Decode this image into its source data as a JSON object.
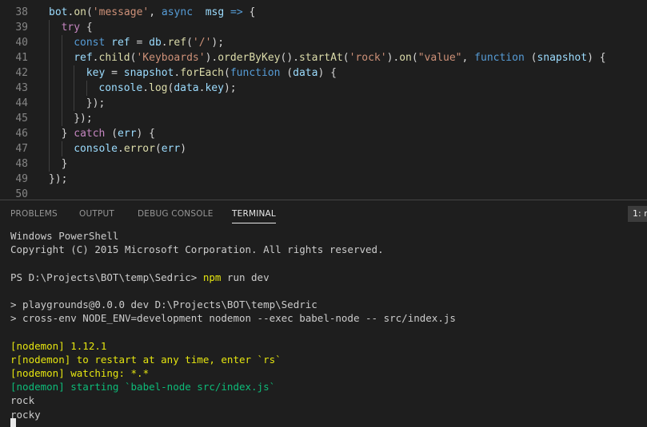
{
  "colors": {
    "keyword": "#c586c0",
    "storage": "#569cd6",
    "variable": "#9cdcfe",
    "function": "#dcdcaa",
    "string": "#ce9178",
    "plain": "#d4d4d4",
    "line_number": "#858585",
    "terminal_yellow": "#e5e510",
    "terminal_green": "#0dbc79"
  },
  "editor": {
    "lines": [
      {
        "num": "38",
        "indent": 0,
        "tokens": [
          {
            "t": "bot",
            "c": "variable"
          },
          {
            "t": ".",
            "c": "plain"
          },
          {
            "t": "on",
            "c": "function"
          },
          {
            "t": "(",
            "c": "plain"
          },
          {
            "t": "'message'",
            "c": "string"
          },
          {
            "t": ", ",
            "c": "plain"
          },
          {
            "t": "async",
            "c": "storage"
          },
          {
            "t": "  ",
            "c": "plain"
          },
          {
            "t": "msg",
            "c": "variable"
          },
          {
            "t": " ",
            "c": "plain"
          },
          {
            "t": "=>",
            "c": "storage"
          },
          {
            "t": " {",
            "c": "plain"
          }
        ]
      },
      {
        "num": "39",
        "indent": 1,
        "tokens": [
          {
            "t": "try",
            "c": "keyword"
          },
          {
            "t": " {",
            "c": "plain"
          }
        ]
      },
      {
        "num": "40",
        "indent": 2,
        "tokens": [
          {
            "t": "const",
            "c": "storage"
          },
          {
            "t": " ",
            "c": "plain"
          },
          {
            "t": "ref",
            "c": "variable"
          },
          {
            "t": " = ",
            "c": "plain"
          },
          {
            "t": "db",
            "c": "variable"
          },
          {
            "t": ".",
            "c": "plain"
          },
          {
            "t": "ref",
            "c": "function"
          },
          {
            "t": "(",
            "c": "plain"
          },
          {
            "t": "'/'",
            "c": "string"
          },
          {
            "t": ");",
            "c": "plain"
          }
        ]
      },
      {
        "num": "41",
        "indent": 2,
        "tokens": [
          {
            "t": "ref",
            "c": "variable"
          },
          {
            "t": ".",
            "c": "plain"
          },
          {
            "t": "child",
            "c": "function"
          },
          {
            "t": "(",
            "c": "plain"
          },
          {
            "t": "'Keyboards'",
            "c": "string"
          },
          {
            "t": ").",
            "c": "plain"
          },
          {
            "t": "orderByKey",
            "c": "function"
          },
          {
            "t": "().",
            "c": "plain"
          },
          {
            "t": "startAt",
            "c": "function"
          },
          {
            "t": "(",
            "c": "plain"
          },
          {
            "t": "'rock'",
            "c": "string"
          },
          {
            "t": ").",
            "c": "plain"
          },
          {
            "t": "on",
            "c": "function"
          },
          {
            "t": "(",
            "c": "plain"
          },
          {
            "t": "\"value\"",
            "c": "string"
          },
          {
            "t": ", ",
            "c": "plain"
          },
          {
            "t": "function",
            "c": "storage"
          },
          {
            "t": " (",
            "c": "plain"
          },
          {
            "t": "snapshot",
            "c": "variable"
          },
          {
            "t": ") {",
            "c": "plain"
          }
        ]
      },
      {
        "num": "42",
        "indent": 3,
        "tokens": [
          {
            "t": "key",
            "c": "variable"
          },
          {
            "t": " = ",
            "c": "plain"
          },
          {
            "t": "snapshot",
            "c": "variable"
          },
          {
            "t": ".",
            "c": "plain"
          },
          {
            "t": "forEach",
            "c": "function"
          },
          {
            "t": "(",
            "c": "plain"
          },
          {
            "t": "function",
            "c": "storage"
          },
          {
            "t": " (",
            "c": "plain"
          },
          {
            "t": "data",
            "c": "variable"
          },
          {
            "t": ") {",
            "c": "plain"
          }
        ]
      },
      {
        "num": "43",
        "indent": 4,
        "tokens": [
          {
            "t": "console",
            "c": "variable"
          },
          {
            "t": ".",
            "c": "plain"
          },
          {
            "t": "log",
            "c": "function"
          },
          {
            "t": "(",
            "c": "plain"
          },
          {
            "t": "data",
            "c": "variable"
          },
          {
            "t": ".",
            "c": "plain"
          },
          {
            "t": "key",
            "c": "variable"
          },
          {
            "t": ");",
            "c": "plain"
          }
        ]
      },
      {
        "num": "44",
        "indent": 3,
        "tokens": [
          {
            "t": "});",
            "c": "plain"
          }
        ]
      },
      {
        "num": "45",
        "indent": 2,
        "tokens": [
          {
            "t": "});",
            "c": "plain"
          }
        ]
      },
      {
        "num": "46",
        "indent": 1,
        "tokens": [
          {
            "t": "} ",
            "c": "plain"
          },
          {
            "t": "catch",
            "c": "keyword"
          },
          {
            "t": " (",
            "c": "plain"
          },
          {
            "t": "err",
            "c": "variable"
          },
          {
            "t": ") {",
            "c": "plain"
          }
        ]
      },
      {
        "num": "47",
        "indent": 2,
        "tokens": [
          {
            "t": "console",
            "c": "variable"
          },
          {
            "t": ".",
            "c": "plain"
          },
          {
            "t": "error",
            "c": "function"
          },
          {
            "t": "(",
            "c": "plain"
          },
          {
            "t": "err",
            "c": "variable"
          },
          {
            "t": ")",
            "c": "plain"
          }
        ]
      },
      {
        "num": "48",
        "indent": 1,
        "tokens": [
          {
            "t": "}",
            "c": "plain"
          }
        ]
      },
      {
        "num": "49",
        "indent": 0,
        "tokens": [
          {
            "t": "});",
            "c": "plain"
          }
        ]
      },
      {
        "num": "50",
        "indent": 0,
        "tokens": []
      }
    ]
  },
  "panel": {
    "tabs": [
      "PROBLEMS",
      "OUTPUT",
      "DEBUG CONSOLE",
      "TERMINAL"
    ],
    "active_tab": "TERMINAL",
    "terminal_selector": "1: r"
  },
  "terminal": {
    "lines": [
      {
        "segments": [
          {
            "t": "Windows PowerShell",
            "c": "plain"
          }
        ]
      },
      {
        "segments": [
          {
            "t": "Copyright (C) 2015 Microsoft Corporation. All rights reserved.",
            "c": "plain"
          }
        ]
      },
      {
        "segments": []
      },
      {
        "segments": [
          {
            "t": "PS D:\\Projects\\BOT\\temp\\Sedric> ",
            "c": "plain"
          },
          {
            "t": "npm",
            "c": "yellow"
          },
          {
            "t": " run dev",
            "c": "plain"
          }
        ]
      },
      {
        "segments": []
      },
      {
        "segments": [
          {
            "t": "> playgrounds@0.0.0 dev D:\\Projects\\BOT\\temp\\Sedric",
            "c": "plain"
          }
        ]
      },
      {
        "segments": [
          {
            "t": "> cross-env NODE_ENV=development nodemon --exec babel-node -- src/index.js",
            "c": "plain"
          }
        ]
      },
      {
        "segments": []
      },
      {
        "segments": [
          {
            "t": "[nodemon] 1.12.1",
            "c": "yellow"
          }
        ]
      },
      {
        "segments": [
          {
            "t": "r[nodemon] to restart at any time, enter `rs`",
            "c": "yellow"
          }
        ]
      },
      {
        "segments": [
          {
            "t": "[nodemon] watching: *.*",
            "c": "yellow"
          }
        ]
      },
      {
        "segments": [
          {
            "t": "[nodemon] starting `babel-node src/index.js`",
            "c": "green"
          }
        ]
      },
      {
        "segments": [
          {
            "t": "rock",
            "c": "plain"
          }
        ]
      },
      {
        "segments": [
          {
            "t": "rocky",
            "c": "plain"
          }
        ]
      }
    ]
  }
}
